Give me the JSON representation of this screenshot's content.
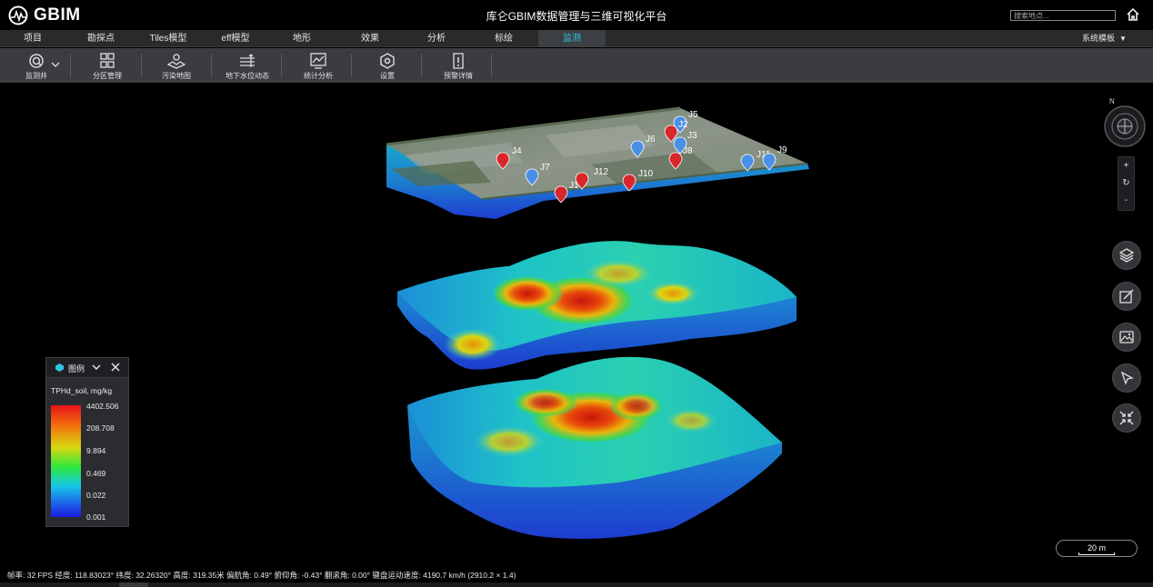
{
  "app": {
    "logo_text": "GBIM",
    "title": "库仑GBIM数据管理与三维可视化平台",
    "search_placeholder": "搜索地点..."
  },
  "menu": {
    "items": [
      {
        "label": "项目"
      },
      {
        "label": "勘探点"
      },
      {
        "label": "Tiles模型"
      },
      {
        "label": "eff模型"
      },
      {
        "label": "地形"
      },
      {
        "label": "效果"
      },
      {
        "label": "分析"
      },
      {
        "label": "标绘"
      },
      {
        "label": "监测",
        "active": true
      }
    ],
    "system_template": "系统模板",
    "accent_color": "#2ec7e0"
  },
  "toolbar": {
    "tools": [
      {
        "label": "监测井",
        "icon": "monitor-well-icon"
      },
      {
        "label": "分区管理",
        "icon": "grid-icon"
      },
      {
        "label": "污染地图",
        "icon": "map-icon"
      },
      {
        "label": "地下水位动态",
        "icon": "water-level-icon"
      },
      {
        "label": "统计分析",
        "icon": "chart-icon"
      },
      {
        "label": "设置",
        "icon": "settings-icon"
      },
      {
        "label": "预警详情",
        "icon": "alert-icon"
      }
    ]
  },
  "markers": {
    "labels": [
      "J5",
      "J2",
      "J3",
      "J6",
      "J4",
      "J8",
      "J11",
      "J9",
      "J7",
      "J12",
      "J10",
      "J1"
    ],
    "blue_color": "#4a8fe8",
    "red_color": "#d8262a"
  },
  "compass": {
    "north": "N"
  },
  "zoom": {
    "in": "+",
    "reset": "↻",
    "out": "-"
  },
  "side_buttons": [
    "layers-icon",
    "draw-icon",
    "image-icon",
    "pointer-icon",
    "collapse-icon"
  ],
  "legend": {
    "title": "图例",
    "subtitle": "TPHd_soil, mg/kg",
    "values": [
      "4402.506",
      "208.708",
      "9.894",
      "0.469",
      "0.022",
      "0.001"
    ]
  },
  "scale": {
    "text": "20 m"
  },
  "status": {
    "text": "帧率: 32 FPS 经度: 118.83023° 纬度: 32.26320° 高度: 319.35米 偏航角: 0.49° 俯仰角: -0.43° 翻滚角: 0.00° 键盘运动速度: 4190.7 km/h (2910.2 × 1.4)"
  }
}
